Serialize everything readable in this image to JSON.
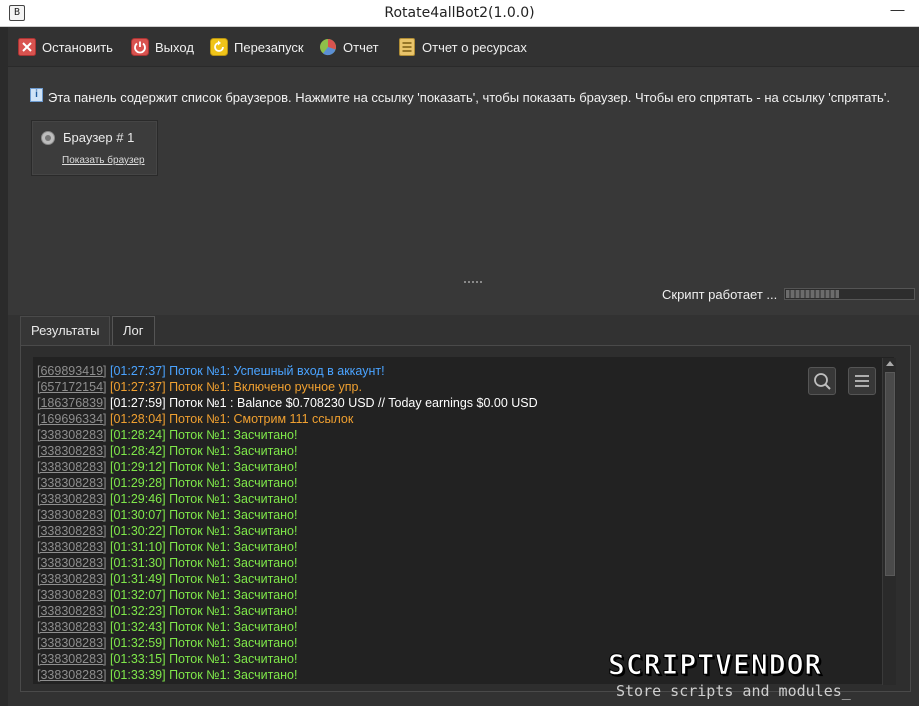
{
  "window": {
    "title": "Rotate4allBot2(1.0.0)",
    "app_icon_glyph": "B",
    "minimize_glyph": "—"
  },
  "toolbar": {
    "stop_label": "Остановить",
    "exit_label": "Выход",
    "restart_label": "Перезапуск",
    "report_label": "Отчет",
    "resource_report_label": "Отчет о ресурсах"
  },
  "panel": {
    "info_text": "Эта панель содержит список браузеров. Нажмите на ссылку 'показать', чтобы показать браузер. Чтобы его спрятать - на ссылку 'спрятать'.",
    "browser_name": "Браузер # 1",
    "browser_link": "Показать браузер",
    "script_status": "Скрипт работает ...",
    "progress_fraction": 0.42
  },
  "tabs": {
    "results": "Результаты",
    "log": "Лог"
  },
  "log": {
    "lines": [
      {
        "id": "[669893419]",
        "text": "[01:27:37] Поток №1: Успешный вход в аккаунт!",
        "color": "blue"
      },
      {
        "id": "[657172154]",
        "text": "[01:27:37] Поток №1: Включено ручное упр.",
        "color": "orange"
      },
      {
        "id": "[186376839]",
        "text": "[01:27:59] Поток №1 : Balance $0.708230 USD // Today earnings $0.00 USD",
        "color": "white"
      },
      {
        "id": "[169696334]",
        "text": "[01:28:04] Поток №1: Смотрим 111 ссылок",
        "color": "orange"
      },
      {
        "id": "[338308283]",
        "text": "[01:28:24] Поток №1: Засчитано!",
        "color": "green"
      },
      {
        "id": "[338308283]",
        "text": "[01:28:42] Поток №1: Засчитано!",
        "color": "green"
      },
      {
        "id": "[338308283]",
        "text": "[01:29:12] Поток №1: Засчитано!",
        "color": "green"
      },
      {
        "id": "[338308283]",
        "text": "[01:29:28] Поток №1: Засчитано!",
        "color": "green"
      },
      {
        "id": "[338308283]",
        "text": "[01:29:46] Поток №1: Засчитано!",
        "color": "green"
      },
      {
        "id": "[338308283]",
        "text": "[01:30:07] Поток №1: Засчитано!",
        "color": "green"
      },
      {
        "id": "[338308283]",
        "text": "[01:30:22] Поток №1: Засчитано!",
        "color": "green"
      },
      {
        "id": "[338308283]",
        "text": "[01:31:10] Поток №1: Засчитано!",
        "color": "green"
      },
      {
        "id": "[338308283]",
        "text": "[01:31:30] Поток №1: Засчитано!",
        "color": "green"
      },
      {
        "id": "[338308283]",
        "text": "[01:31:49] Поток №1: Засчитано!",
        "color": "green"
      },
      {
        "id": "[338308283]",
        "text": "[01:32:07] Поток №1: Засчитано!",
        "color": "green"
      },
      {
        "id": "[338308283]",
        "text": "[01:32:23] Поток №1: Засчитано!",
        "color": "green"
      },
      {
        "id": "[338308283]",
        "text": "[01:32:43] Поток №1: Засчитано!",
        "color": "green"
      },
      {
        "id": "[338308283]",
        "text": "[01:32:59] Поток №1: Засчитано!",
        "color": "green"
      },
      {
        "id": "[338308283]",
        "text": "[01:33:15] Поток №1: Засчитано!",
        "color": "green"
      },
      {
        "id": "[338308283]",
        "text": "[01:33:39] Поток №1: Засчитано!",
        "color": "green"
      }
    ]
  },
  "watermark": {
    "title": "SCRIPTVENDOR",
    "subtitle": "Store scripts and modules_"
  },
  "icons": {
    "stop": "close-icon",
    "exit": "power-icon",
    "restart": "refresh-icon",
    "report": "pie-chart-icon",
    "resource_report": "list-icon",
    "info": "info-icon",
    "browser": "browser-icon",
    "search": "search-icon",
    "menu": "menu-icon"
  },
  "colors": {
    "log_blue": "#4aa3ff",
    "log_orange": "#f0a030",
    "log_white": "#ffffff",
    "log_green": "#7fe84a",
    "log_id": "#8e8e8e"
  }
}
